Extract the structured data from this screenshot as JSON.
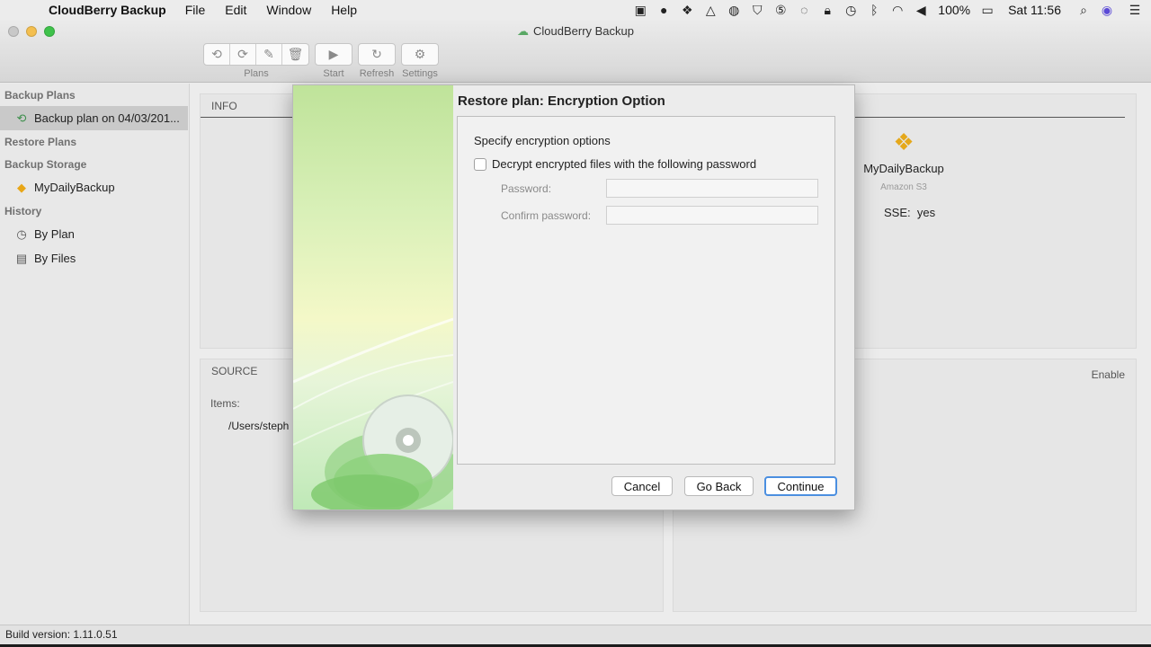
{
  "menubar": {
    "apple_icon": "apple-icon",
    "app_name": "CloudBerry Backup",
    "items": [
      "File",
      "Edit",
      "Window",
      "Help"
    ],
    "battery": "100%",
    "clock": "Sat 11:56"
  },
  "window": {
    "title": "CloudBerry Backup",
    "toolbar": {
      "plans_label": "Plans",
      "start_label": "Start",
      "refresh_label": "Refresh",
      "settings_label": "Settings"
    }
  },
  "sidebar": {
    "backup_plans_heading": "Backup Plans",
    "backup_plan_item": "Backup plan on 04/03/201...",
    "restore_plans_heading": "Restore Plans",
    "backup_storage_heading": "Backup Storage",
    "storage_item": "MyDailyBackup",
    "history_heading": "History",
    "by_plan": "By Plan",
    "by_files": "By Files"
  },
  "main": {
    "info_heading": "INFO",
    "storage_name": "MyDailyBackup",
    "storage_type": "Amazon S3",
    "sse_label": "SSE:",
    "sse_value": "yes",
    "source_heading": "SOURCE",
    "items_label": "Items:",
    "item_path": "/Users/steph",
    "enable_label": "Enable"
  },
  "dialog": {
    "title": "Restore plan: Encryption Option",
    "section_label": "Specify encryption options",
    "checkbox_label": "Decrypt encrypted files with the following password",
    "checkbox_checked": false,
    "password_label": "Password:",
    "password_value": "",
    "confirm_label": "Confirm password:",
    "confirm_value": "",
    "cancel_label": "Cancel",
    "goback_label": "Go Back",
    "continue_label": "Continue"
  },
  "statusbar": {
    "build": "Build version: 1.11.0.51"
  },
  "colors": {
    "accent": "#4b8fe0",
    "storage_gold": "#e5a81b",
    "art_green": "#bfe39a"
  }
}
